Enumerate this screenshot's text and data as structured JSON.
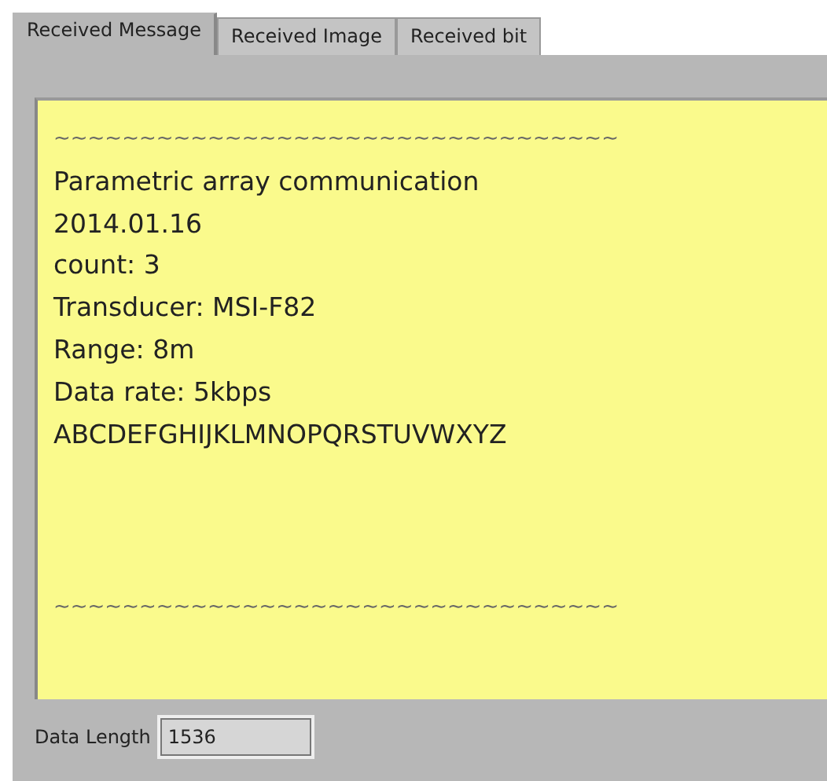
{
  "tabs": [
    {
      "label": "Received Message",
      "selected": true
    },
    {
      "label": "Received Image",
      "selected": false
    },
    {
      "label": "Received bit",
      "selected": false
    }
  ],
  "message": {
    "lines": [
      "~~~~~~~~~~~~~~~~~~~~~~~~~~~~~~~~~",
      "Parametric array communication",
      "2014.01.16",
      "count: 3",
      "Transducer: MSI-F82",
      "Range: 8m",
      "Data rate: 5kbps",
      "ABCDEFGHIJKLMNOPQRSTUVWXYZ"
    ],
    "footer_line": "~~~~~~~~~~~~~~~~~~~~~~~~~~~~~~~~~"
  },
  "data_length": {
    "label": "Data Length",
    "value": "1536"
  }
}
